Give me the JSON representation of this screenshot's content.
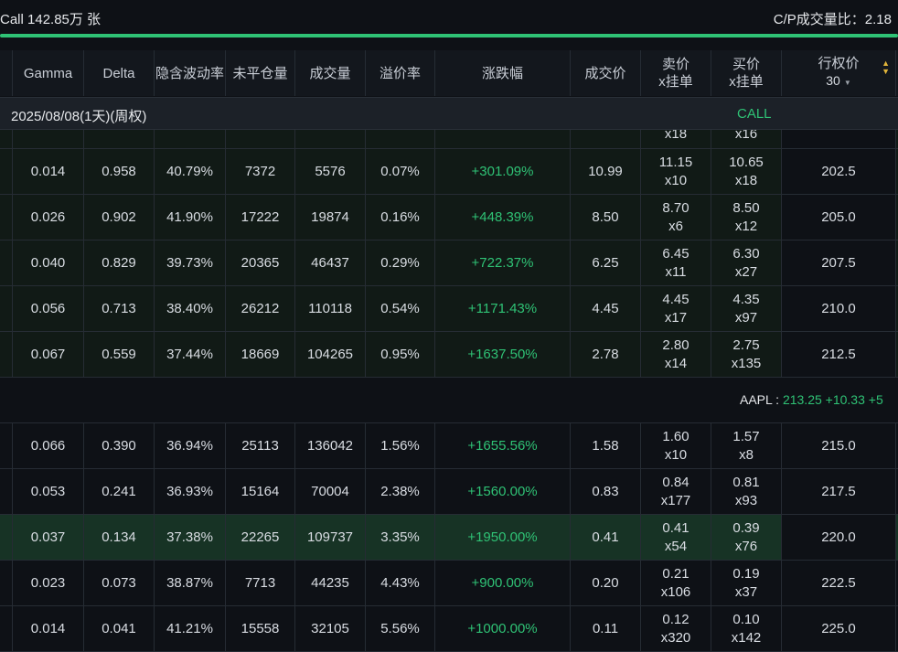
{
  "summary": {
    "left_text": "Call 142.85万 张",
    "right_text": "C/P成交量比：2.18",
    "progress_fraction": 1.0
  },
  "columns": {
    "gamma": "Gamma",
    "delta": "Delta",
    "iv": "隐含波动率",
    "oi": "未平仓量",
    "volume": "成交量",
    "premium": "溢价率",
    "change": "涨跌幅",
    "last": "成交价",
    "ask_l1": "卖价",
    "ask_l2": "x挂单",
    "bid_l1": "买价",
    "bid_l2": "x挂单",
    "strike": "行权价",
    "strike_count": "30"
  },
  "expiry": {
    "date": "2025/08/08(1天)(周权)",
    "side": "CALL"
  },
  "partial_row": {
    "ask_size": "x18",
    "bid_size": "x16"
  },
  "rows_itm": [
    {
      "gamma": "0.014",
      "delta": "0.958",
      "iv": "40.79%",
      "oi": "7372",
      "volume": "5576",
      "premium": "0.07%",
      "change": "+301.09%",
      "last": "10.99",
      "ask": "11.15",
      "ask_size": "x10",
      "bid": "10.65",
      "bid_size": "x18",
      "strike": "202.5"
    },
    {
      "gamma": "0.026",
      "delta": "0.902",
      "iv": "41.90%",
      "oi": "17222",
      "volume": "19874",
      "premium": "0.16%",
      "change": "+448.39%",
      "last": "8.50",
      "ask": "8.70",
      "ask_size": "x6",
      "bid": "8.50",
      "bid_size": "x12",
      "strike": "205.0"
    },
    {
      "gamma": "0.040",
      "delta": "0.829",
      "iv": "39.73%",
      "oi": "20365",
      "volume": "46437",
      "premium": "0.29%",
      "change": "+722.37%",
      "last": "6.25",
      "ask": "6.45",
      "ask_size": "x11",
      "bid": "6.30",
      "bid_size": "x27",
      "strike": "207.5"
    },
    {
      "gamma": "0.056",
      "delta": "0.713",
      "iv": "38.40%",
      "oi": "26212",
      "volume": "110118",
      "premium": "0.54%",
      "change": "+1171.43%",
      "last": "4.45",
      "ask": "4.45",
      "ask_size": "x17",
      "bid": "4.35",
      "bid_size": "x97",
      "strike": "210.0"
    },
    {
      "gamma": "0.067",
      "delta": "0.559",
      "iv": "37.44%",
      "oi": "18669",
      "volume": "104265",
      "premium": "0.95%",
      "change": "+1637.50%",
      "last": "2.78",
      "ask": "2.80",
      "ask_size": "x14",
      "bid": "2.75",
      "bid_size": "x135",
      "strike": "212.5"
    }
  ],
  "spot": {
    "label": "AAPL : ",
    "price": "213.25 +10.33 +5"
  },
  "rows_otm": [
    {
      "gamma": "0.066",
      "delta": "0.390",
      "iv": "36.94%",
      "oi": "25113",
      "volume": "136042",
      "premium": "1.56%",
      "change": "+1655.56%",
      "last": "1.58",
      "ask": "1.60",
      "ask_size": "x10",
      "bid": "1.57",
      "bid_size": "x8",
      "strike": "215.0"
    },
    {
      "gamma": "0.053",
      "delta": "0.241",
      "iv": "36.93%",
      "oi": "15164",
      "volume": "70004",
      "premium": "2.38%",
      "change": "+1560.00%",
      "last": "0.83",
      "ask": "0.84",
      "ask_size": "x177",
      "bid": "0.81",
      "bid_size": "x93",
      "strike": "217.5"
    },
    {
      "gamma": "0.037",
      "delta": "0.134",
      "iv": "37.38%",
      "oi": "22265",
      "volume": "109737",
      "premium": "3.35%",
      "change": "+1950.00%",
      "last": "0.41",
      "ask": "0.41",
      "ask_size": "x54",
      "bid": "0.39",
      "bid_size": "x76",
      "strike": "220.0"
    },
    {
      "gamma": "0.023",
      "delta": "0.073",
      "iv": "38.87%",
      "oi": "7713",
      "volume": "44235",
      "premium": "4.43%",
      "change": "+900.00%",
      "last": "0.20",
      "ask": "0.21",
      "ask_size": "x106",
      "bid": "0.19",
      "bid_size": "x37",
      "strike": "222.5"
    },
    {
      "gamma": "0.014",
      "delta": "0.041",
      "iv": "41.21%",
      "oi": "15558",
      "volume": "32105",
      "premium": "5.56%",
      "change": "+1000.00%",
      "last": "0.11",
      "ask": "0.12",
      "ask_size": "x320",
      "bid": "0.10",
      "bid_size": "x142",
      "strike": "225.0"
    }
  ],
  "highlight_strike": "220.0",
  "colors": {
    "up": "#2fc275",
    "sort_icon": "#e0b43a",
    "bg": "#0e1116"
  }
}
